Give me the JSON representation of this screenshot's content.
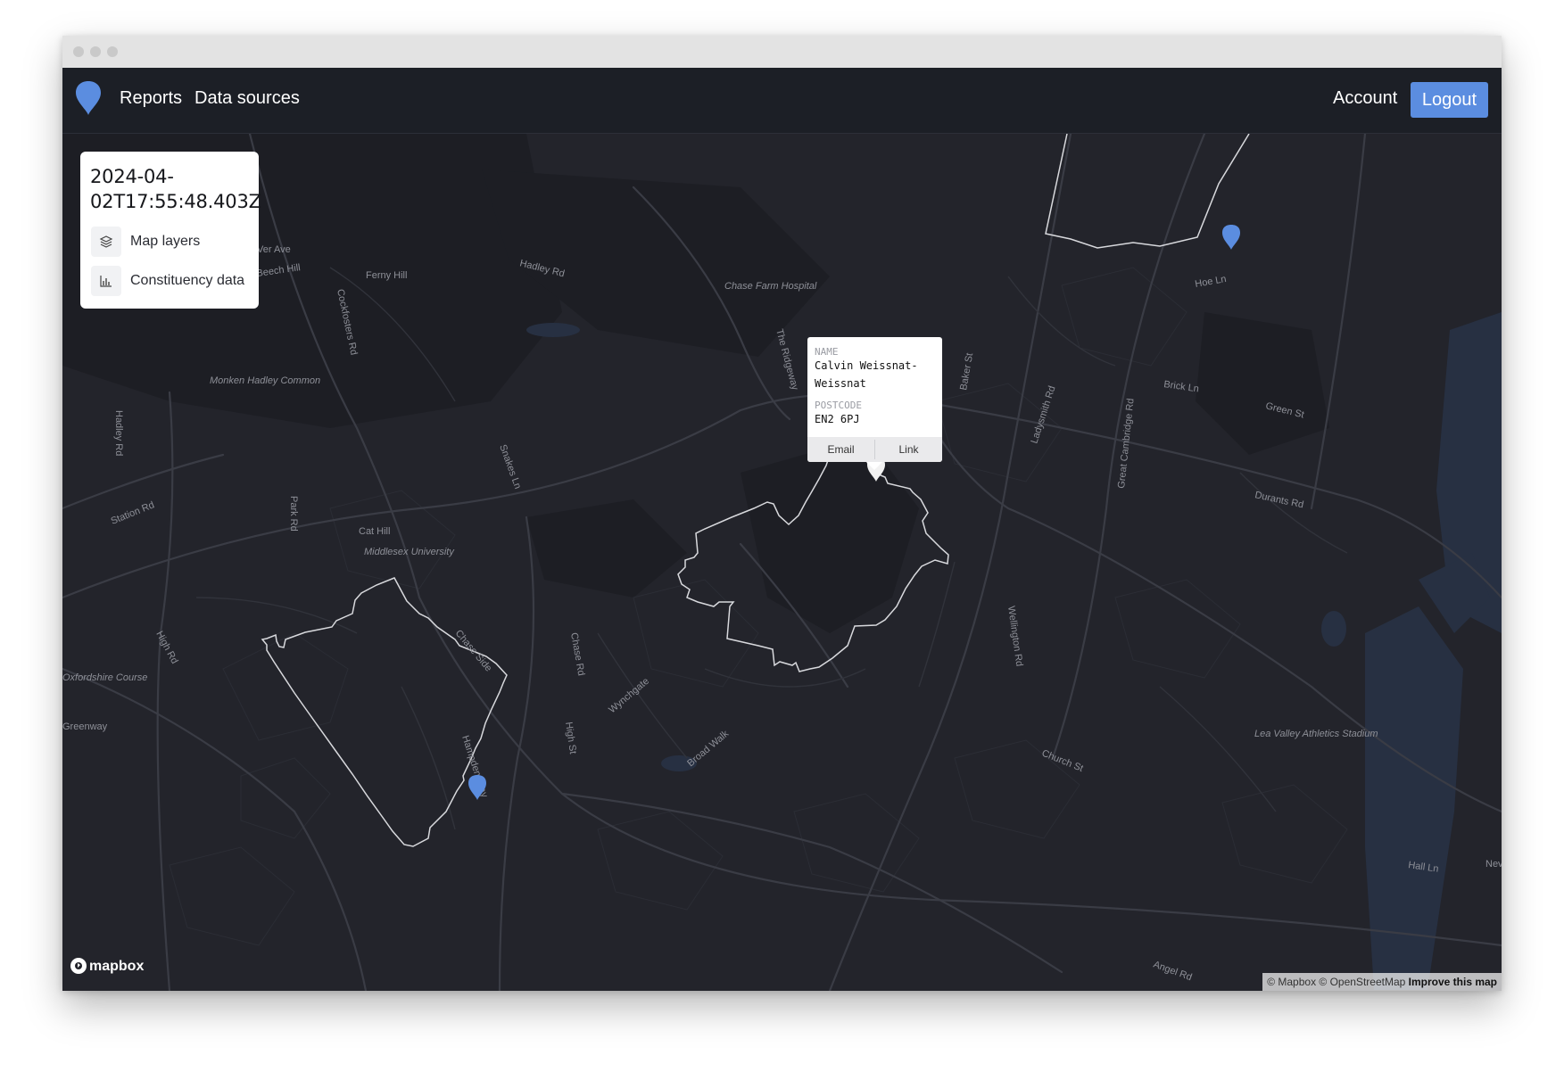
{
  "nav": {
    "links": [
      "Reports",
      "Data sources"
    ],
    "account": "Account",
    "logout": "Logout"
  },
  "report_panel": {
    "title": "2024-04-02T17:55:48.403Z",
    "items": [
      {
        "label": "Map layers",
        "icon": "layers-icon"
      },
      {
        "label": "Constituency data",
        "icon": "bar-chart-icon"
      }
    ]
  },
  "popup": {
    "name_label": "NAME",
    "name": "Calvin Weissnat-Weissnat",
    "postcode_label": "POSTCODE",
    "postcode": "EN2 6PJ",
    "actions": [
      "Email",
      "Link"
    ]
  },
  "map": {
    "street_labels": [
      "Ferny Hill",
      "Hadley Rd",
      "Cockfosters Rd",
      "Chase Farm Hospital",
      "The Ridgeway",
      "Baker St",
      "Hoe Ln",
      "Brick Ln",
      "Green St",
      "Ladysmith Rd",
      "Great Cambridge Rd",
      "Durants Rd",
      "Monken Hadley Common",
      "Hadley Rd",
      "Snakes Ln",
      "Station Rd",
      "Park Rd",
      "Cat Hill",
      "Middlesex University",
      "Chase Side",
      "Chase Rd",
      "Wellington Rd",
      "Wynchgate",
      "Broad Walk",
      "High St",
      "High Rd",
      "Hampden Way",
      "Church St",
      "Lea Valley Athletics Stadium",
      "Hall Ln",
      "Angel Rd",
      "Beech Hill",
      "Ver Ave",
      "Greenway",
      "Oxfordshire Course",
      "Nev"
    ],
    "logo_text": "mapbox",
    "attribution": "© Mapbox © OpenStreetMap",
    "improve_link": "Improve this map",
    "marker_color": "#5b8de0"
  }
}
